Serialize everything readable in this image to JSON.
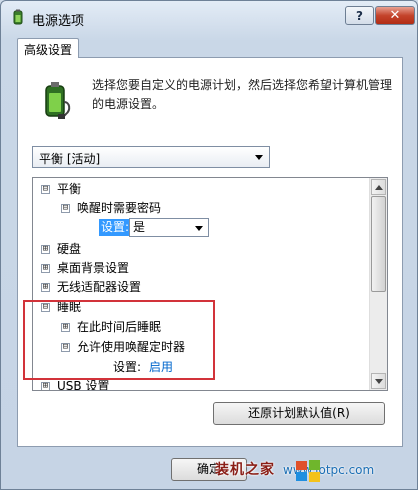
{
  "window": {
    "title": "电源选项",
    "help_label": "?",
    "close_label": "✕"
  },
  "tab": {
    "label": "高级设置"
  },
  "description": "选择您要自定义的电源计划，然后选择您希望计算机管理的电源设置。",
  "plan_select": {
    "value": "平衡 [活动]"
  },
  "tree": {
    "balanced": {
      "label": "平衡",
      "expander": "⊟"
    },
    "require_password": {
      "label": "唤醒时需要密码",
      "expander": "⊟"
    },
    "password_setting": {
      "prefix": "设置:",
      "value": "是"
    },
    "hard_disk": {
      "label": "硬盘",
      "expander": "⊞"
    },
    "desktop_bg": {
      "label": "桌面背景设置",
      "expander": "⊞"
    },
    "wireless": {
      "label": "无线适配器设置",
      "expander": "⊞"
    },
    "sleep": {
      "label": "睡眠",
      "expander": "⊟"
    },
    "sleep_after": {
      "label": "在此时间后睡眠",
      "expander": "⊞"
    },
    "wake_timers": {
      "label": "允许使用唤醒定时器",
      "expander": "⊟"
    },
    "wake_setting": {
      "prefix": "设置:",
      "value": "启用"
    },
    "usb": {
      "label": "USB 设置",
      "expander": "⊞"
    }
  },
  "buttons": {
    "restore": "还原计划默认值(R)",
    "ok": "确定"
  },
  "watermark": {
    "text": "装机之家",
    "url": "www.lotpc.com"
  },
  "colors": {
    "selection": "#3399ff",
    "highlight_box": "#d2333a",
    "link": "#0066cc"
  }
}
